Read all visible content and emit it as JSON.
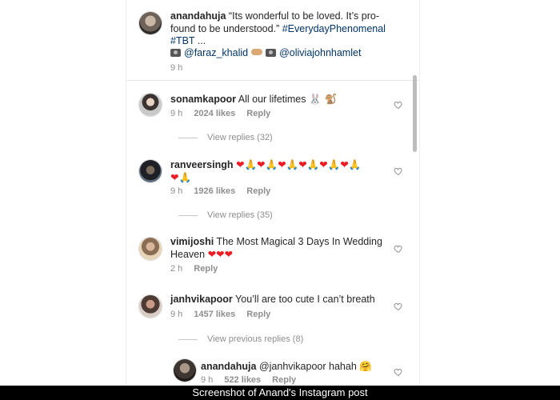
{
  "caption": {
    "username": "anandahuja",
    "text_line1": "“Its wonderful to be loved. It’s pro-",
    "text_line2_prefix": "found to be understood.”",
    "hashtag1": "#EverydayPhenomenal",
    "hashtag2": "#TBT",
    "ellipsis": "...",
    "mention1": "@faraz_khalid",
    "mention2": "@oliviajohnhamlet",
    "time": "9 h"
  },
  "comments": [
    {
      "username": "sonamkapoor",
      "text": "All our lifetimes",
      "emoji": "🐰 🐒",
      "time": "9 h",
      "likes": "2024 likes",
      "reply": "Reply",
      "view_replies": "View replies (32)"
    },
    {
      "username": "ranveersingh",
      "emoji_line1": "❤🙏❤🙏❤🙏❤🙏❤🙏❤🙏",
      "emoji_line2": "❤🙏",
      "time": "9 h",
      "likes": "1926 likes",
      "reply": "Reply",
      "view_replies": "View replies (35)"
    },
    {
      "username": "vimijoshi",
      "text_line1": "The Most Magical 3 Days In Wedding",
      "text_line2": "Heaven",
      "emoji": "❤❤❤",
      "time": "2 h",
      "reply": "Reply"
    },
    {
      "username": "janhvikapoor",
      "text": "You’ll are too cute I can’t breath",
      "time": "9 h",
      "likes": "1457 likes",
      "reply": "Reply",
      "view_replies": "View previous replies (8)"
    }
  ],
  "reply": {
    "username": "anandahuja",
    "mention": "@janhvikapoor",
    "text": "hahah",
    "emoji": "🤗",
    "time": "9 h",
    "likes": "522 likes",
    "reply": "Reply"
  },
  "banner": "Screenshot of Anand's Instagram post",
  "colors": {
    "link": "#003569",
    "meta": "#8e8e8e",
    "text": "#262626",
    "heart_red": "#ed1c24"
  },
  "icons": [
    "heart-outline-icon",
    "camera-icon",
    "pointing-finger-icon"
  ]
}
